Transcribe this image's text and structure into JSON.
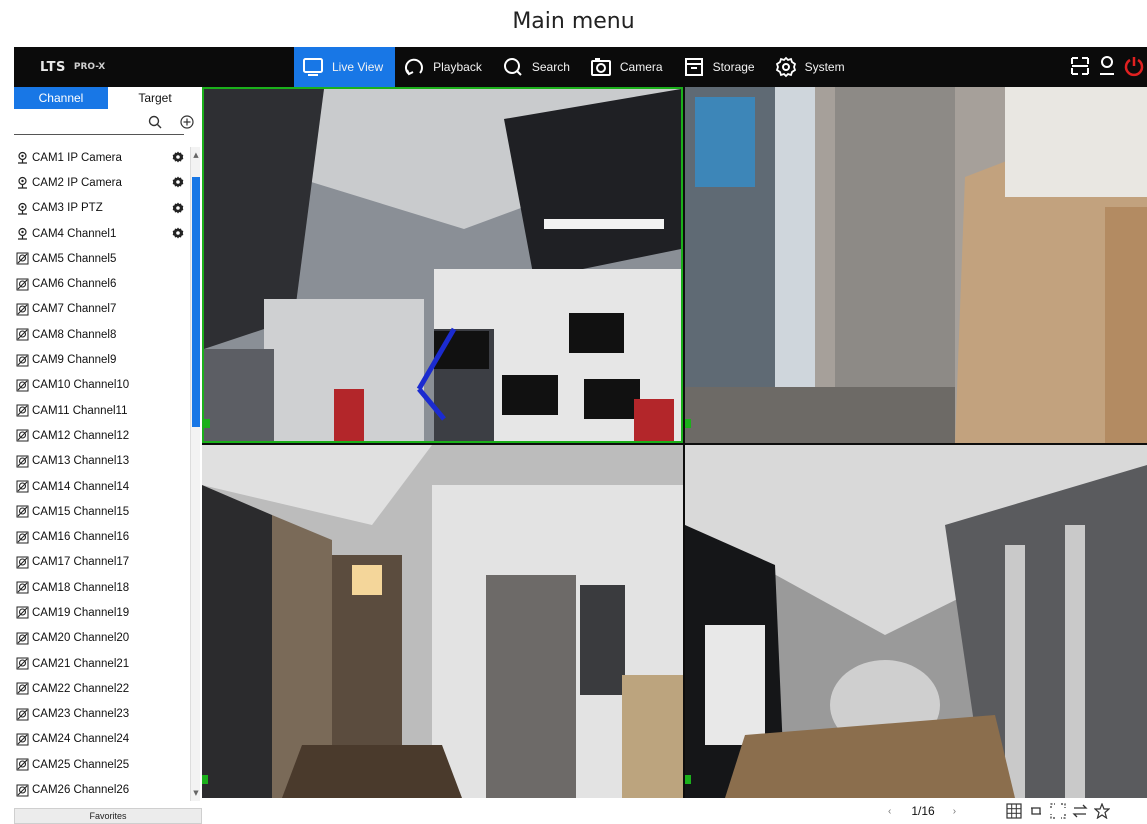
{
  "caption": "Main menu",
  "app": {
    "logo": "LTS",
    "logo_sub": "PRO-X"
  },
  "nav": [
    {
      "label": "Live View",
      "icon": "monitor-icon",
      "active": true
    },
    {
      "label": "Playback",
      "icon": "playback-icon"
    },
    {
      "label": "Search",
      "icon": "search-icon"
    },
    {
      "label": "Camera",
      "icon": "camera-icon"
    },
    {
      "label": "Storage",
      "icon": "storage-icon"
    },
    {
      "label": "System",
      "icon": "gear-icon"
    }
  ],
  "top_right_icons": [
    "layout-icon",
    "user-icon",
    "power-icon"
  ],
  "sidebar": {
    "tabs": [
      {
        "label": "Channel",
        "active": true
      },
      {
        "label": "Target"
      }
    ],
    "cameras": [
      {
        "label": "CAM1 IP Camera",
        "online": true
      },
      {
        "label": "CAM2 IP Camera",
        "online": true
      },
      {
        "label": "CAM3 IP PTZ",
        "online": true
      },
      {
        "label": "CAM4 Channel1",
        "online": true
      },
      {
        "label": "CAM5 Channel5"
      },
      {
        "label": "CAM6 Channel6"
      },
      {
        "label": "CAM7 Channel7"
      },
      {
        "label": "CAM8 Channel8"
      },
      {
        "label": "CAM9 Channel9"
      },
      {
        "label": "CAM10 Channel10"
      },
      {
        "label": "CAM11 Channel11"
      },
      {
        "label": "CAM12 Channel12"
      },
      {
        "label": "CAM13 Channel13"
      },
      {
        "label": "CAM14 Channel14"
      },
      {
        "label": "CAM15 Channel15"
      },
      {
        "label": "CAM16 Channel16"
      },
      {
        "label": "CAM17 Channel17"
      },
      {
        "label": "CAM18 Channel18"
      },
      {
        "label": "CAM19 Channel19"
      },
      {
        "label": "CAM20 Channel20"
      },
      {
        "label": "CAM21 Channel21"
      },
      {
        "label": "CAM22 Channel22"
      },
      {
        "label": "CAM23 Channel23"
      },
      {
        "label": "CAM24 Channel24"
      },
      {
        "label": "CAM25 Channel25"
      },
      {
        "label": "CAM26 Channel26"
      }
    ],
    "favorites_label": "Favorites"
  },
  "pagination": {
    "current": "1/16"
  },
  "bottom_tools": [
    "grid-layout-icon",
    "rotate-icon",
    "fullscreen-icon",
    "swap-icon",
    "star-icon"
  ],
  "colors": {
    "accent": "#1877e6",
    "topbar": "#0b0b0b",
    "selected_tile": "#1bb01b",
    "power": "#e02020"
  }
}
